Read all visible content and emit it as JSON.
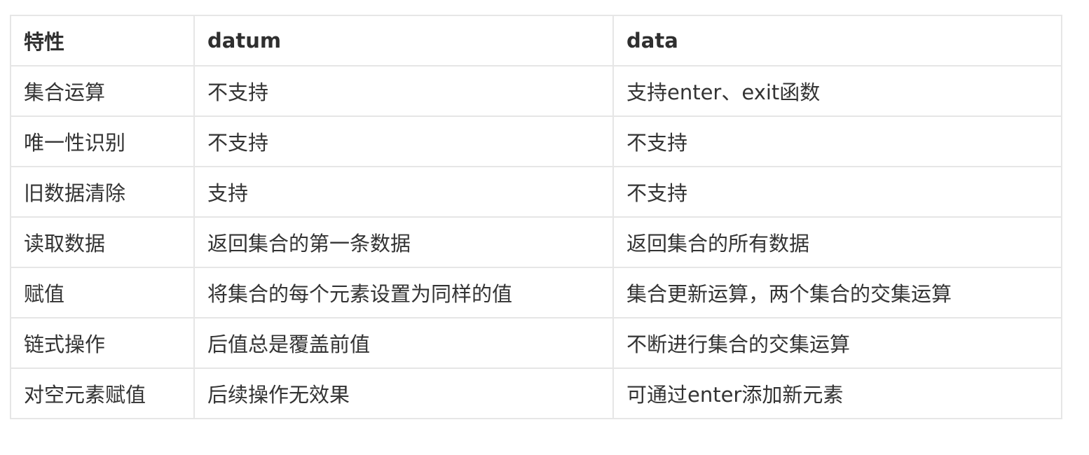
{
  "table": {
    "headers": [
      "特性",
      "datum",
      "data"
    ],
    "rows": [
      [
        "集合运算",
        "不支持",
        "支持enter、exit函数"
      ],
      [
        "唯一性识别",
        "不支持",
        "不支持"
      ],
      [
        "旧数据清除",
        "支持",
        "不支持"
      ],
      [
        "读取数据",
        "返回集合的第一条数据",
        "返回集合的所有数据"
      ],
      [
        "赋值",
        "将集合的每个元素设置为同样的值",
        "集合更新运算，两个集合的交集运算"
      ],
      [
        "链式操作",
        "后值总是覆盖前值",
        "不断进行集合的交集运算"
      ],
      [
        "对空元素赋值",
        "后续操作无效果",
        "可通过enter添加新元素"
      ]
    ]
  }
}
